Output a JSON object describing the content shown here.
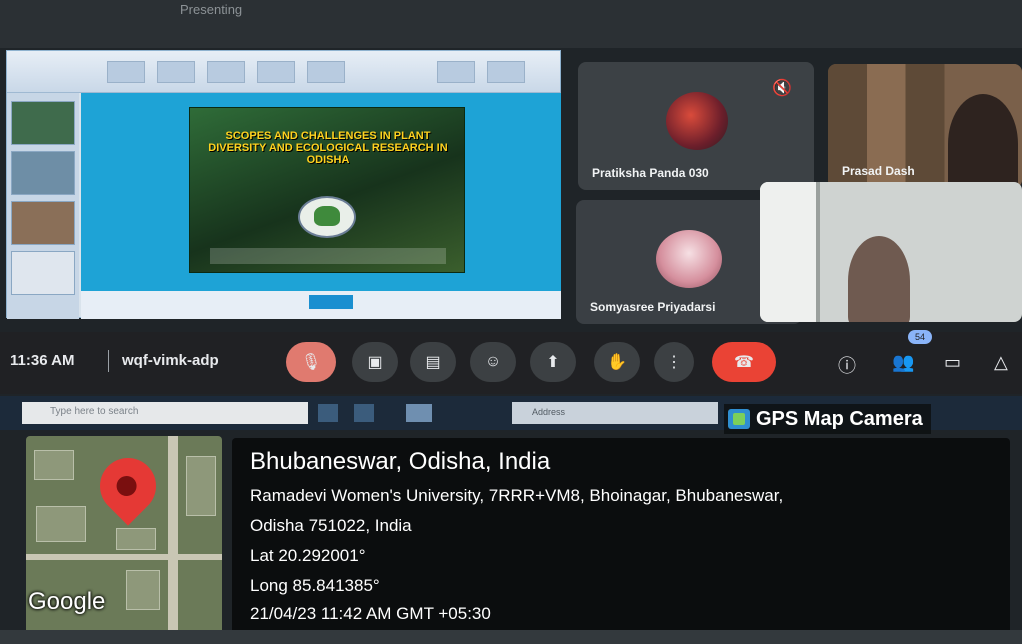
{
  "top_bar": {
    "partial_text": "Presenting"
  },
  "presentation": {
    "slide_title": "SCOPES AND CHALLENGES IN PLANT DIVERSITY AND ECOLOGICAL RESEARCH IN ODISHA"
  },
  "participants": [
    {
      "name": "Pratiksha Panda 030",
      "muted": true
    },
    {
      "name": "Prasad Dash"
    },
    {
      "name": "Somyasree Priyadarsi"
    },
    {
      "name": ""
    }
  ],
  "meet_bar": {
    "time": "11:36 AM",
    "separator": "|",
    "meeting_code": "wqf-vimk-adp",
    "controls": [
      "mic-off",
      "camera",
      "captions",
      "emoji",
      "present",
      "raise-hand",
      "more",
      "leave-call"
    ],
    "participant_count": "54"
  },
  "taskbar": {
    "search_placeholder": "Type here to search",
    "address_label": "Address"
  },
  "gps_overlay": {
    "brand": "GPS Map Camera",
    "title": "Bhubaneswar, Odisha, India",
    "address_line1": "Ramadevi Women's University, 7RRR+VM8, Bhoinagar, Bhubaneswar,",
    "address_line2": "Odisha 751022, India",
    "lat": "Lat 20.292001°",
    "long": "Long 85.841385°",
    "datetime": "21/04/23 11:42 AM GMT +05:30",
    "map_attribution": "Google"
  },
  "colors": {
    "meet_bar_bg": "#202124",
    "leave_red": "#ea4335",
    "pin_red": "#e53935"
  }
}
